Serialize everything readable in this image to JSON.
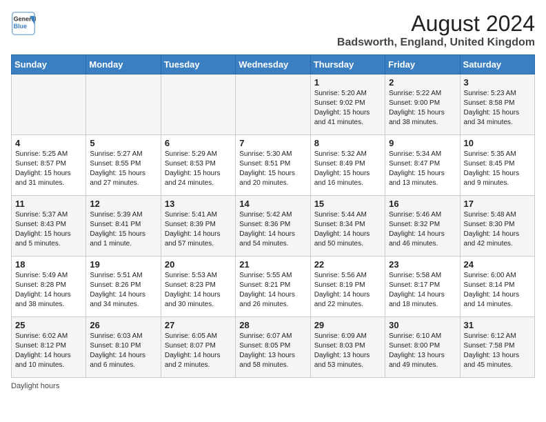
{
  "header": {
    "logo_general": "General",
    "logo_blue": "Blue",
    "month_year": "August 2024",
    "location": "Badsworth, England, United Kingdom"
  },
  "days_of_week": [
    "Sunday",
    "Monday",
    "Tuesday",
    "Wednesday",
    "Thursday",
    "Friday",
    "Saturday"
  ],
  "weeks": [
    [
      {
        "day": "",
        "info": ""
      },
      {
        "day": "",
        "info": ""
      },
      {
        "day": "",
        "info": ""
      },
      {
        "day": "",
        "info": ""
      },
      {
        "day": "1",
        "info": "Sunrise: 5:20 AM\nSunset: 9:02 PM\nDaylight: 15 hours\nand 41 minutes."
      },
      {
        "day": "2",
        "info": "Sunrise: 5:22 AM\nSunset: 9:00 PM\nDaylight: 15 hours\nand 38 minutes."
      },
      {
        "day": "3",
        "info": "Sunrise: 5:23 AM\nSunset: 8:58 PM\nDaylight: 15 hours\nand 34 minutes."
      }
    ],
    [
      {
        "day": "4",
        "info": "Sunrise: 5:25 AM\nSunset: 8:57 PM\nDaylight: 15 hours\nand 31 minutes."
      },
      {
        "day": "5",
        "info": "Sunrise: 5:27 AM\nSunset: 8:55 PM\nDaylight: 15 hours\nand 27 minutes."
      },
      {
        "day": "6",
        "info": "Sunrise: 5:29 AM\nSunset: 8:53 PM\nDaylight: 15 hours\nand 24 minutes."
      },
      {
        "day": "7",
        "info": "Sunrise: 5:30 AM\nSunset: 8:51 PM\nDaylight: 15 hours\nand 20 minutes."
      },
      {
        "day": "8",
        "info": "Sunrise: 5:32 AM\nSunset: 8:49 PM\nDaylight: 15 hours\nand 16 minutes."
      },
      {
        "day": "9",
        "info": "Sunrise: 5:34 AM\nSunset: 8:47 PM\nDaylight: 15 hours\nand 13 minutes."
      },
      {
        "day": "10",
        "info": "Sunrise: 5:35 AM\nSunset: 8:45 PM\nDaylight: 15 hours\nand 9 minutes."
      }
    ],
    [
      {
        "day": "11",
        "info": "Sunrise: 5:37 AM\nSunset: 8:43 PM\nDaylight: 15 hours\nand 5 minutes."
      },
      {
        "day": "12",
        "info": "Sunrise: 5:39 AM\nSunset: 8:41 PM\nDaylight: 15 hours\nand 1 minute."
      },
      {
        "day": "13",
        "info": "Sunrise: 5:41 AM\nSunset: 8:39 PM\nDaylight: 14 hours\nand 57 minutes."
      },
      {
        "day": "14",
        "info": "Sunrise: 5:42 AM\nSunset: 8:36 PM\nDaylight: 14 hours\nand 54 minutes."
      },
      {
        "day": "15",
        "info": "Sunrise: 5:44 AM\nSunset: 8:34 PM\nDaylight: 14 hours\nand 50 minutes."
      },
      {
        "day": "16",
        "info": "Sunrise: 5:46 AM\nSunset: 8:32 PM\nDaylight: 14 hours\nand 46 minutes."
      },
      {
        "day": "17",
        "info": "Sunrise: 5:48 AM\nSunset: 8:30 PM\nDaylight: 14 hours\nand 42 minutes."
      }
    ],
    [
      {
        "day": "18",
        "info": "Sunrise: 5:49 AM\nSunset: 8:28 PM\nDaylight: 14 hours\nand 38 minutes."
      },
      {
        "day": "19",
        "info": "Sunrise: 5:51 AM\nSunset: 8:26 PM\nDaylight: 14 hours\nand 34 minutes."
      },
      {
        "day": "20",
        "info": "Sunrise: 5:53 AM\nSunset: 8:23 PM\nDaylight: 14 hours\nand 30 minutes."
      },
      {
        "day": "21",
        "info": "Sunrise: 5:55 AM\nSunset: 8:21 PM\nDaylight: 14 hours\nand 26 minutes."
      },
      {
        "day": "22",
        "info": "Sunrise: 5:56 AM\nSunset: 8:19 PM\nDaylight: 14 hours\nand 22 minutes."
      },
      {
        "day": "23",
        "info": "Sunrise: 5:58 AM\nSunset: 8:17 PM\nDaylight: 14 hours\nand 18 minutes."
      },
      {
        "day": "24",
        "info": "Sunrise: 6:00 AM\nSunset: 8:14 PM\nDaylight: 14 hours\nand 14 minutes."
      }
    ],
    [
      {
        "day": "25",
        "info": "Sunrise: 6:02 AM\nSunset: 8:12 PM\nDaylight: 14 hours\nand 10 minutes."
      },
      {
        "day": "26",
        "info": "Sunrise: 6:03 AM\nSunset: 8:10 PM\nDaylight: 14 hours\nand 6 minutes."
      },
      {
        "day": "27",
        "info": "Sunrise: 6:05 AM\nSunset: 8:07 PM\nDaylight: 14 hours\nand 2 minutes."
      },
      {
        "day": "28",
        "info": "Sunrise: 6:07 AM\nSunset: 8:05 PM\nDaylight: 13 hours\nand 58 minutes."
      },
      {
        "day": "29",
        "info": "Sunrise: 6:09 AM\nSunset: 8:03 PM\nDaylight: 13 hours\nand 53 minutes."
      },
      {
        "day": "30",
        "info": "Sunrise: 6:10 AM\nSunset: 8:00 PM\nDaylight: 13 hours\nand 49 minutes."
      },
      {
        "day": "31",
        "info": "Sunrise: 6:12 AM\nSunset: 7:58 PM\nDaylight: 13 hours\nand 45 minutes."
      }
    ]
  ],
  "footer": {
    "daylight_label": "Daylight hours"
  }
}
